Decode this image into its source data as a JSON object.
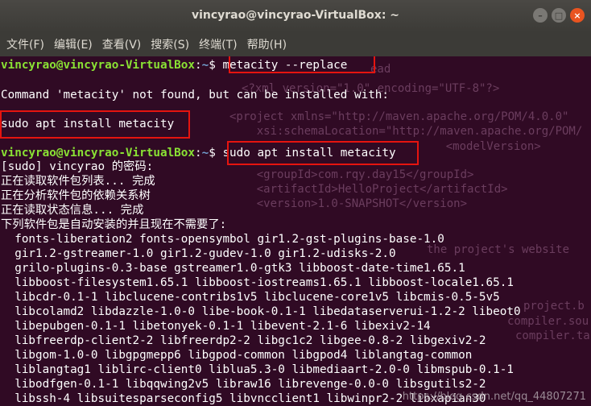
{
  "window": {
    "title": "vincyrao@vincyrao-VirtualBox: ~",
    "min_icon": "minimize-icon",
    "max_icon": "maximize-icon",
    "close_icon": "close-icon"
  },
  "menu": [
    "文件(F)",
    "编辑(E)",
    "查看(V)",
    "搜索(S)",
    "终端(T)",
    "帮助(H)"
  ],
  "prompt": {
    "user_host": "vincyrao@vincyrao-VirtualBox",
    "path": "~",
    "sep": "$"
  },
  "terminal": {
    "cmd1": "metacity --replace",
    "error_line": "Command 'metacity' not found, but can be installed with:",
    "suggestion": "sudo apt install metacity",
    "cmd2": "sudo apt install metacity",
    "output": [
      "[sudo] vincyrao 的密码:",
      "正在读取软件包列表... 完成",
      "正在分析软件包的依赖关系树",
      "正在读取状态信息... 完成",
      "下列软件包是自动安装的并且现在不需要了:",
      "  fonts-liberation2 fonts-opensymbol gir1.2-gst-plugins-base-1.0",
      "  gir1.2-gstreamer-1.0 gir1.2-gudev-1.0 gir1.2-udisks-2.0",
      "  grilo-plugins-0.3-base gstreamer1.0-gtk3 libboost-date-time1.65.1",
      "  libboost-filesystem1.65.1 libboost-iostreams1.65.1 libboost-locale1.65.1",
      "  libcdr-0.1-1 libclucene-contribs1v5 libclucene-core1v5 libcmis-0.5-5v5",
      "  libcolamd2 libdazzle-1.0-0 libe-book-0.1-1 libedataserverui-1.2-2 libeot0",
      "  libepubgen-0.1-1 libetonyek-0.1-1 libevent-2.1-6 libexiv2-14",
      "  libfreerdp-client2-2 libfreerdp2-2 libgc1c2 libgee-0.8-2 libgexiv2-2",
      "  libgom-1.0-0 libgpgmepp6 libgpod-common libgpod4 liblangtag-common",
      "  liblangtag1 liblirc-client0 liblua5.3-0 libmediaart-2.0-0 libmspub-0.1-1",
      "  libodfgen-0.1-1 libqqwing2v5 libraw16 librevenge-0.0-0 libsgutils2-2",
      "  libssh-4 libsuitesparseconfig5 libvncclient1 libwinpr2-2 libxapian30"
    ]
  },
  "ghost_text": [
    "ead",
    "<?xml version=\"1.0\" encoding=\"UTF-8\"?>",
    "<project xmlns=\"http://maven.apache.org/POM/4.0.0\"",
    "    xsi:schemaLocation=\"http://maven.apache.org/POM/",
    "    <modelVersion>",
    "    <groupId>com.rqy.day15</groupId>",
    "    <artifactId>HelloProject</artifactId>",
    "    <version>1.0-SNAPSHOT</version>",
    "the project's website",
    "project.b",
    "compiler.sou",
    "compiler.tar"
  ],
  "watermark": "https://blog.csdn.net/qq_44807271"
}
